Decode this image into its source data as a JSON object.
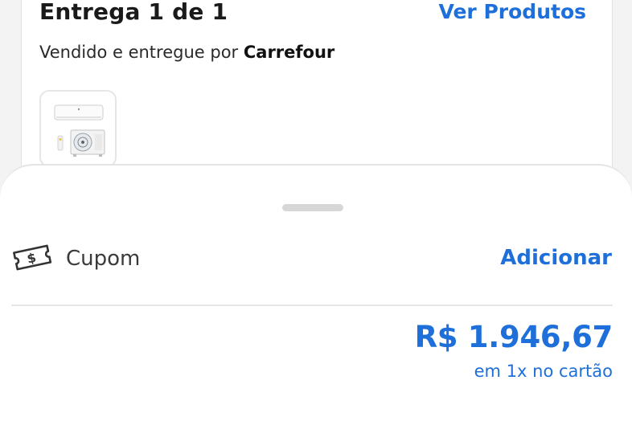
{
  "delivery": {
    "title": "Entrega 1 de 1",
    "view_products_label": "Ver Produtos",
    "seller_prefix": "Vendido e entregue por ",
    "seller_name": "Carrefour",
    "product_thumb_icon": "air-conditioner-split-image"
  },
  "sheet": {
    "coupon": {
      "icon": "coupon-ticket-icon",
      "label": "Cupom",
      "action_label": "Adicionar"
    },
    "total": {
      "price": "R$ 1.946,67",
      "installment": "em 1x no cartão"
    }
  },
  "colors": {
    "accent": "#1e6fd9",
    "text_dark": "#1a1a1a",
    "background": "#f3f3f3"
  }
}
